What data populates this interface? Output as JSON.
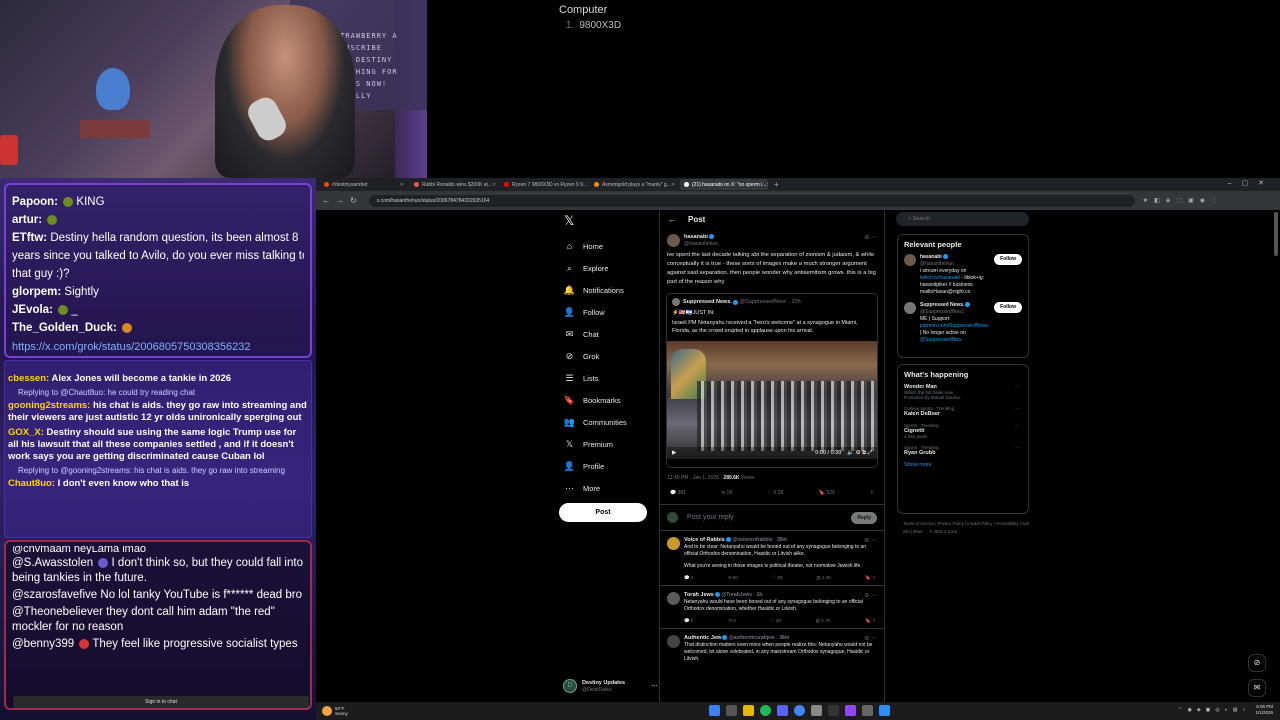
{
  "desktop": {
    "title": "Computer",
    "items": [
      {
        "num": "1.",
        "label": "9800X3D"
      }
    ]
  },
  "webcam": {
    "sign_lines": [
      "STRAWBERRY A",
      "SUBSCRIBE",
      "MEY DESTINY",
      "WATCHING FOR",
      "YEARS NOW!",
      "FINALLY"
    ]
  },
  "chat_top": {
    "lines": [
      {
        "user": "Papoon:",
        "text": "KING"
      },
      {
        "user": "artur:",
        "text": ""
      },
      {
        "user": "ETftw:",
        "text": "Destiny hella random question, its been almost 8"
      },
      {
        "user": "",
        "text": "years since you talked to Avilo, do you ever miss talking to"
      },
      {
        "user": "",
        "text": "that guy :)?"
      },
      {
        "user": "glorpem:",
        "text": "Sightly"
      },
      {
        "user": "JEvola:",
        "text": "_"
      },
      {
        "user": "The_Golden_Duck:",
        "text": ""
      }
    ],
    "link": "https://x.com/grok/status/2006805750308356232"
  },
  "chat_mid": {
    "messages": [
      {
        "user": "cbessen:",
        "text": "Alex Jones will become a tankie in 2026",
        "reply": "Replying to @Chaut8uo: he could try reading chat"
      },
      {
        "user": "gooning2streams:",
        "text": "his chat is aids. they go raw into streaming and their viewers are just autistic 12 yr olds unironically sperging out",
        "reply": ""
      },
      {
        "user": "GOX_X:",
        "text": "Destiny should sue using the same logic Trump use for all his lawsuit that all these companies settled , and if it doesn't work says you are getting discriminated cause Cuban lol",
        "reply": "Replying to @gooning2streams: his chat is aids. they go raw into streaming"
      },
      {
        "user": "Chaut8uo:",
        "text": "I don't even know who that is",
        "reply": ""
      }
    ]
  },
  "chat_bot": {
    "messages": [
      {
        "user": "@S.Awasstolen",
        "text": "I don't think so, but they could fall into being tankies in the future."
      },
      {
        "user": "@szarosfavefive",
        "text": "No lol tanky YouTube is f****** dead bro"
      },
      {
        "user": "@Theonebeliever",
        "text": "they dont call him adam \"the red\" mockler for no reason"
      },
      {
        "user": "@benny399",
        "text": "They feel like progressive socialist types"
      }
    ],
    "partial_top": "@chvmaam  heyLama lmao",
    "sign_in": "Sign in to chat"
  },
  "browser": {
    "tabs": [
      {
        "label": "r/destinysamfed",
        "color": "#ff4500",
        "active": false
      },
      {
        "label": "Rabbi Ronaldo wins $200K at...",
        "color": "#e55",
        "active": false
      },
      {
        "label": "Ryzen 7 9800X3D vs Ryzen 9 9...",
        "color": "#f00",
        "active": false
      },
      {
        "label": "Asmongold plays a \"manly\" g...",
        "color": "#f80",
        "active": false
      },
      {
        "label": "(21) hasanabi on X: \"no sperm i...",
        "color": "#fff",
        "active": true
      }
    ],
    "url": "x.com/hasanthehun/status/2006784784332635164",
    "new_tab": "+"
  },
  "x_nav": {
    "logo": "𝕏",
    "items": [
      {
        "icon": "⌂",
        "label": "Home"
      },
      {
        "icon": "⌕",
        "label": "Explore"
      },
      {
        "icon": "🔔",
        "label": "Notifications"
      },
      {
        "icon": "👤",
        "label": "Follow"
      },
      {
        "icon": "✉",
        "label": "Chat"
      },
      {
        "icon": "⊘",
        "label": "Grok"
      },
      {
        "icon": "☰",
        "label": "Lists"
      },
      {
        "icon": "🔖",
        "label": "Bookmarks"
      },
      {
        "icon": "👥",
        "label": "Communities"
      },
      {
        "icon": "𝕏",
        "label": "Premium"
      },
      {
        "icon": "👤",
        "label": "Profile"
      },
      {
        "icon": "⋯",
        "label": "More"
      }
    ],
    "post_button": "Post",
    "account": {
      "name": "Destiny Updates",
      "handle": "@DestiDarko"
    }
  },
  "post": {
    "header": "Post",
    "author": "hasanabi",
    "handle": "@hasanthehun",
    "text": "ive spent the last decade talking abt the separation of zionism & judaism, & while conceptually it is true - these sorts of images make a much stronger argument against said separation. then people wonder why antisemitism grows. this is a big part of the reason why",
    "quote": {
      "author": "Suppressed News.",
      "handle": "@SuppressedNws! · 20h",
      "line1": "⚡🇺🇸🇮🇱JUST IN:",
      "text": "Israeli PM Netanyahu received a \"hero's welcome\" at a synagogue in Miami, Florida, as the crowd erupted in applause upon his arrival.",
      "video_time": "0:00 / 0:39"
    },
    "meta_time": "12:49 PM · Jan 1, 2026 · ",
    "views_num": "289.6K",
    "views_label": " Views",
    "stats": {
      "replies": "381",
      "reposts": "1K",
      "likes": "6.2K",
      "bookmarks": "520"
    },
    "reply_placeholder": "Post your reply",
    "reply_button": "Reply"
  },
  "replies": [
    {
      "name": "Voice of Rabbis",
      "handle": "@voicesofrabbis · 39m",
      "avatar": "#c89a2a",
      "text": "And to be clear: Netanyahu would be booed out of any synagogue belonging to an official Orthodox denomination, Hasidic or Litvish alike.",
      "text2": "What you're seeing in those images is political theater, not normative Jewish life.",
      "stats": [
        "1",
        "50",
        "28",
        "1.2K"
      ]
    },
    {
      "name": "Torah Jews",
      "handle": "@TorahJews · 1h",
      "avatar": "#5a5a5a",
      "text": "Netanyahu would have been booed out of any synagogue belonging to an official Orthodox denomination, whether Hasidic or Litvish.",
      "text2": "",
      "stats": [
        "5",
        "8",
        "36",
        "2.7K"
      ]
    },
    {
      "name": "Authentic Jew",
      "handle": "@authenticorahjew · 38m",
      "avatar": "#444",
      "text": "That distinction matters even more when people realize this: Netanyahu would not be welcomed, let alone celebrated, in any mainstream Orthodox synagogue, Hasidic or Litvish.",
      "text2": "",
      "stats": [
        "",
        "",
        "",
        ""
      ]
    }
  ],
  "sidebar": {
    "search_placeholder": "Search",
    "relevant_title": "Relevant people",
    "people": [
      {
        "name": "hasanabi",
        "handle": "@hasanthehun",
        "bio": "i stream everyday on ",
        "link": "twitch.tv/hasanabi",
        "bio2": " - tiktok+ig: hasandpiker // business: mailtoHasan@night.co",
        "button": "Follow"
      },
      {
        "name": "Suppressed News.",
        "handle": "@SuppressedNws1",
        "bio": "ME | Support: ",
        "link": "patreon.com/SuppressedNews",
        "bio2": " | No longer active on ",
        "link2": "@SuppressedNws",
        "button": "Follow"
      }
    ],
    "happening_title": "What's happening",
    "trends": [
      {
        "ctx": "",
        "title": "Wonder Man",
        "sub": "Watch the full trailer now",
        "sub2": "Promoted by Marvel Studios"
      },
      {
        "ctx": "College sports · Trending",
        "title": "Kalen DeBoer",
        "sub": "",
        "sub2": ""
      },
      {
        "ctx": "Sports · Trending",
        "title": "Cignetti",
        "sub": "3,481 posts",
        "sub2": ""
      },
      {
        "ctx": "Sports · Trending",
        "title": "Ryan Grubb",
        "sub": "",
        "sub2": ""
      }
    ],
    "show_more": "Show more",
    "footer": "Terms of Service  |  Privacy Policy  |  Cookie Policy  |  Accessibility  |  Ads info  |  More ···  © 2026 X Corp."
  },
  "taskbar": {
    "temp": "50°F",
    "cond": "Sunny",
    "time": "5:06 PM",
    "date": "1/1/2026"
  }
}
